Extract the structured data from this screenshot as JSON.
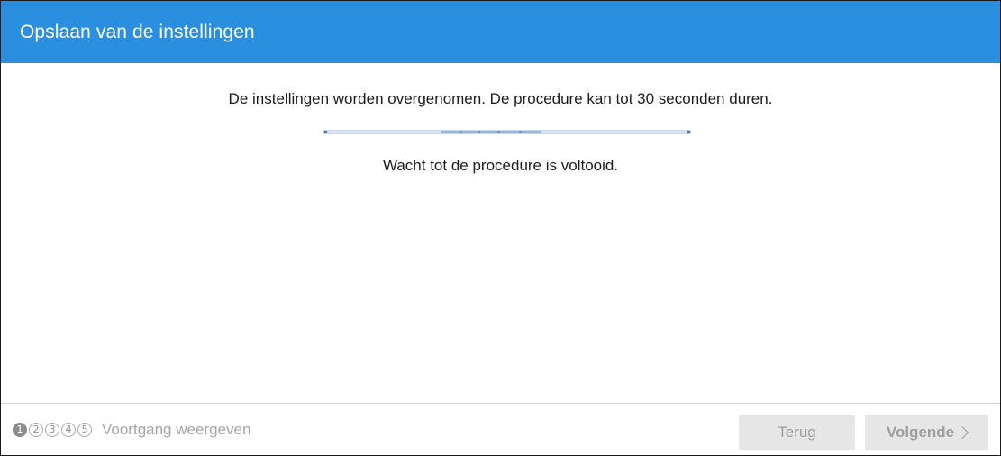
{
  "dialog": {
    "title": "Opslaan van de instellingen"
  },
  "content": {
    "message": "De instellingen worden overgenomen. De procedure kan tot 30 seconden duren.",
    "wait_text": "Wacht tot de procedure is voltooid."
  },
  "footer": {
    "steps": [
      "1",
      "2",
      "3",
      "4",
      "5"
    ],
    "active_step": 1,
    "show_progress_label": "Voortgang weergeven",
    "back_label": "Terug",
    "next_label": "Volgende"
  },
  "colors": {
    "title_bar": "#2b8fe0",
    "button_disabled_bg": "#e6e6e6",
    "button_disabled_text": "#9e9e9e"
  },
  "icons": {
    "next_chevron": "chevron-right-icon"
  }
}
